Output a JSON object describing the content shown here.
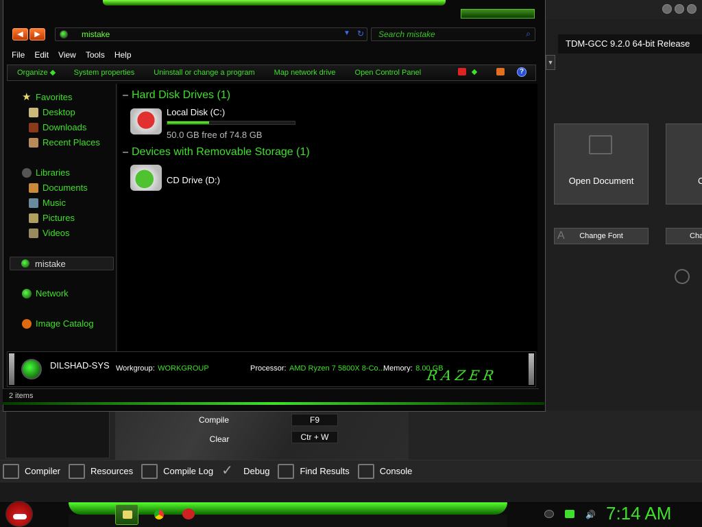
{
  "explorer": {
    "address": "mistake",
    "search_placeholder": "Search mistake",
    "menu": [
      "File",
      "Edit",
      "View",
      "Tools",
      "Help"
    ],
    "commands": [
      "Organize",
      "System properties",
      "Uninstall or change a program",
      "Map network drive",
      "Open Control Panel"
    ],
    "help_icon": "?",
    "sidebar": {
      "favorites": {
        "label": "Favorites",
        "items": [
          "Desktop",
          "Downloads",
          "Recent Places"
        ]
      },
      "libraries": {
        "label": "Libraries",
        "items": [
          "Documents",
          "Music",
          "Pictures",
          "Videos"
        ]
      },
      "current": "mistake",
      "network": "Network",
      "catalog": "Image Catalog"
    },
    "groups": {
      "hdd": "Hard Disk Drives (1)",
      "removable": "Devices with Removable Storage (1)"
    },
    "drives": {
      "local": {
        "name": "Local Disk (C:)",
        "free_text": "50.0 GB free of 74.8 GB",
        "used_fraction": 0.33
      },
      "cd": {
        "name": "CD Drive (D:)"
      }
    },
    "details": {
      "computer_name": "DILSHAD-SYS",
      "workgroup_label": "Workgroup:",
      "workgroup": "WORKGROUP",
      "processor_label": "Processor:",
      "processor": "AMD Ryzen 7 5800X 8-Co...",
      "memory_label": "Memory:",
      "memory": "8.00 GB",
      "brand": "RAZER"
    },
    "status": "2 items"
  },
  "ide": {
    "compiler_header": "TDM-GCC 9.2.0 64-bit Release",
    "tiles": [
      "Open Document",
      "C"
    ],
    "buttons": [
      "Change Font",
      "Cha"
    ],
    "shortcuts": [
      {
        "label": "Compile",
        "key": "F9"
      },
      {
        "label": "Clear",
        "key": "Ctr + W"
      }
    ],
    "tabs": [
      "Compiler",
      "Resources",
      "Compile Log",
      "Debug",
      "Find Results",
      "Console"
    ]
  },
  "taskbar": {
    "apps": [
      "explorer-icon",
      "chrome-icon",
      "devcpp-icon"
    ],
    "clock": "7:14 AM"
  },
  "colors": {
    "accent": "#3fe02a",
    "background": "#0a0a0a"
  }
}
